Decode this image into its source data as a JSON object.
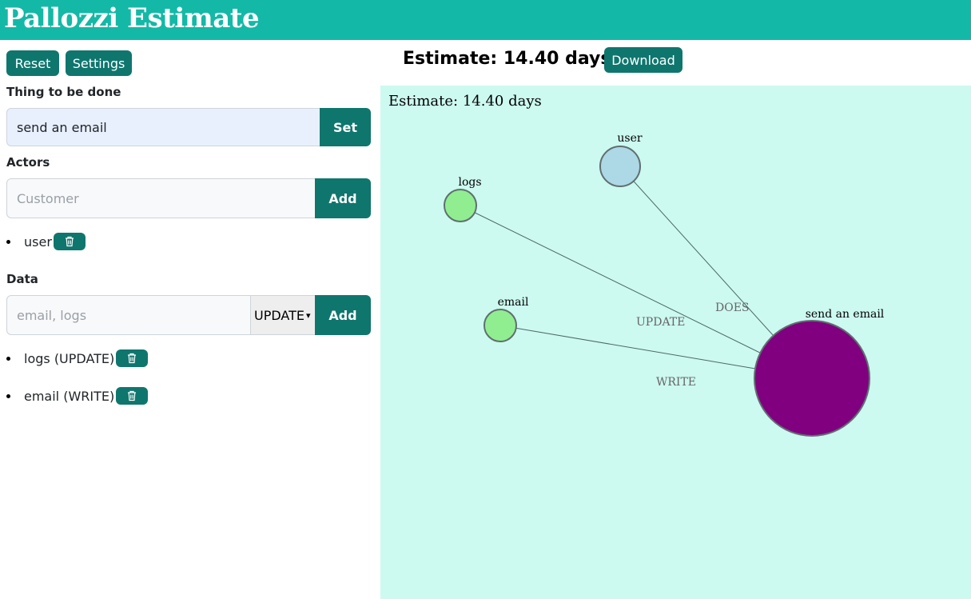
{
  "app": {
    "title": "Pallozzi Estimate"
  },
  "toolbar": {
    "reset_label": "Reset",
    "settings_label": "Settings",
    "download_label": "Download"
  },
  "estimate": {
    "heading": "Estimate: 14.40 days"
  },
  "thing": {
    "label": "Thing to be done",
    "value": "send an email",
    "set_label": "Set"
  },
  "actors": {
    "label": "Actors",
    "placeholder": "Customer",
    "add_label": "Add",
    "items": [
      {
        "label": "user"
      }
    ]
  },
  "data": {
    "label": "Data",
    "placeholder": "email, logs",
    "select_value": "UPDATE",
    "add_label": "Add",
    "items": [
      {
        "label": "logs (UPDATE)"
      },
      {
        "label": "email (WRITE)"
      }
    ]
  },
  "graph": {
    "caption": "Estimate: 14.40 days",
    "nodes": [
      {
        "id": "user",
        "label": "user",
        "color": "#add8e6",
        "kind": "actor"
      },
      {
        "id": "logs",
        "label": "logs",
        "color": "#90ee90",
        "kind": "data"
      },
      {
        "id": "email",
        "label": "email",
        "color": "#90ee90",
        "kind": "data"
      },
      {
        "id": "task",
        "label": "send an email",
        "color": "#800080",
        "kind": "task"
      }
    ],
    "edges": [
      {
        "from": "user",
        "to": "task",
        "label": "DOES"
      },
      {
        "from": "logs",
        "to": "task",
        "label": "UPDATE"
      },
      {
        "from": "email",
        "to": "task",
        "label": "WRITE"
      }
    ]
  },
  "icons": {
    "delete": "trash-icon"
  },
  "colors": {
    "header": "#13b9a6",
    "button": "#0f766e",
    "graph_bg": "#ccf9f0"
  }
}
